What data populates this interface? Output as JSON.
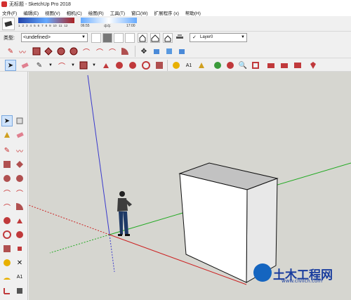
{
  "window": {
    "title": "无标题 - SketchUp Pro 2018"
  },
  "menu": [
    "文件(F)",
    "编辑(E)",
    "视图(V)",
    "相机(C)",
    "绘图(R)",
    "工具(T)",
    "窗口(W)",
    "扩展程序 (x)",
    "帮助(H)"
  ],
  "shadow": {
    "time_ticks": [
      "1",
      "2",
      "3",
      "4",
      "5",
      "6",
      "7",
      "8",
      "9",
      "10",
      "11",
      "12"
    ],
    "time_start": "06:55",
    "time_noon": "中午",
    "time_end": "17:00"
  },
  "tag_bar": {
    "label": "类型:",
    "value": "<undefined>",
    "layer_value": "Layer0"
  },
  "colors": {
    "viewport_bg": "#d6d6d0",
    "axis_blue": "#3a3acc",
    "axis_red": "#cc2222",
    "axis_green": "#22aa22",
    "box_face": "#ffffff",
    "box_side": "#e8e8e8",
    "box_top": "#c2c2c2",
    "selection": "#cfe3fb"
  },
  "watermark": {
    "main": "土木工程网",
    "url": "www.civilcn.com"
  },
  "icons": {
    "toolbar_row1": [
      "pencil-icon",
      "freehand-icon",
      "rectangle-icon",
      "rotated-rect-icon",
      "circle-icon",
      "polygon-icon",
      "arc-icon",
      "arc-2pt-icon",
      "arc-3pt-icon",
      "pie-icon",
      "move-icon",
      "pushpull-icon",
      "rotate-icon",
      "followme-icon",
      "scale-icon",
      "offset-icon"
    ],
    "toolbar_row2": [
      "select-icon",
      "eraser-icon",
      "pencil-icon",
      "arc-icon",
      "rectangle-icon",
      "pushpull-icon",
      "move-icon",
      "rotate-icon",
      "scale-icon",
      "tape-icon",
      "text-icon",
      "paint-icon",
      "orbit-icon",
      "pan-icon",
      "zoom-icon",
      "zoom-extents-icon",
      "warehouse-icon",
      "extension-icon",
      "ruby-icon"
    ]
  }
}
